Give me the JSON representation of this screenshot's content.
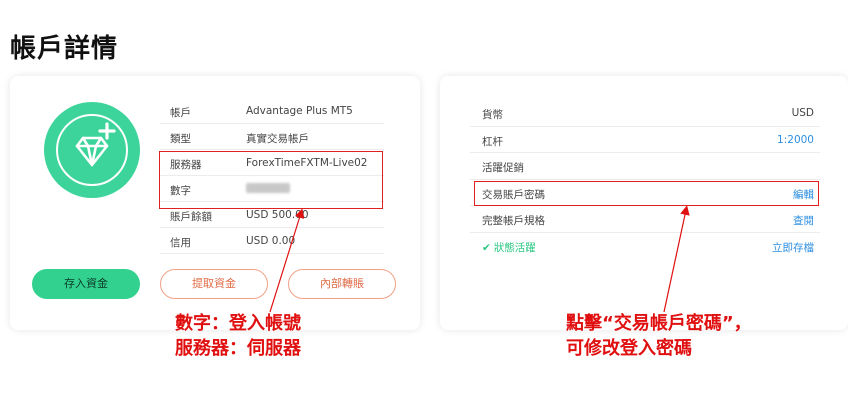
{
  "page": {
    "title": "帳戶詳情"
  },
  "account": {
    "rows": [
      {
        "label": "帳戶",
        "value": "Advantage Plus MT5"
      },
      {
        "label": "類型",
        "value": "真實交易帳戶"
      },
      {
        "label": "服務器",
        "value": "ForexTimeFXTM-Live02"
      },
      {
        "label": "數字",
        "value": ""
      },
      {
        "label": "賬戶餘額",
        "value": "USD 500.00"
      },
      {
        "label": "信用",
        "value": "USD 0.00"
      }
    ],
    "buttons": {
      "deposit": "存入資金",
      "withdraw": "提取資金",
      "transfer": "內部轉賬"
    }
  },
  "details": {
    "rows": [
      {
        "label": "貨幣",
        "value": "USD"
      },
      {
        "label": "杠杆",
        "value": "1:2000"
      },
      {
        "label": "活躍促銷",
        "value": ""
      },
      {
        "label": "交易賬戶密碼",
        "value": "編輯"
      },
      {
        "label": "完整帳戶規格",
        "value": "查閱"
      },
      {
        "label": "狀態活躍",
        "value": "立即存檔"
      }
    ]
  },
  "annotations": {
    "left": [
      "數字：登入帳號",
      "服務器：伺服器"
    ],
    "right": [
      "點擊“交易帳戶密碼”，",
      "可修改登入密碼"
    ]
  },
  "colors": {
    "accent_green": "#32d18f",
    "link_blue": "#2d8fe0",
    "annotation_red": "#e01010",
    "outline_orange": "#f4a088"
  },
  "icons": {
    "avatar": "diamond-plus-icon",
    "status": "check-icon"
  }
}
